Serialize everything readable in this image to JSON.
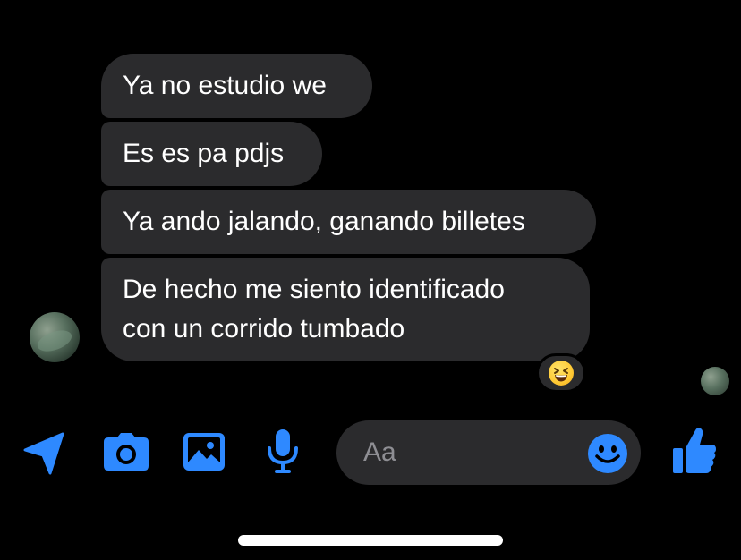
{
  "messages": [
    {
      "text": "Ya no estudio we"
    },
    {
      "text": "Es es pa pdjs"
    },
    {
      "text": "Ya ando jalando, ganando billetes"
    },
    {
      "lines": [
        "De hecho me siento identificado",
        "con un corrido tumbado"
      ]
    }
  ],
  "reaction": {
    "emoji": "grinning-squinting-face"
  },
  "composer": {
    "placeholder": "Aa"
  },
  "icons": {
    "location": "location-arrow-icon",
    "camera": "camera-icon",
    "gallery": "photo-gallery-icon",
    "mic": "microphone-icon",
    "emoji": "smiley-icon",
    "like": "thumbs-up-icon"
  },
  "colors": {
    "background": "#000000",
    "bubble": "#2b2b2d",
    "accent": "#2e89ff",
    "text": "#ffffff",
    "placeholder": "#8e8e93"
  }
}
